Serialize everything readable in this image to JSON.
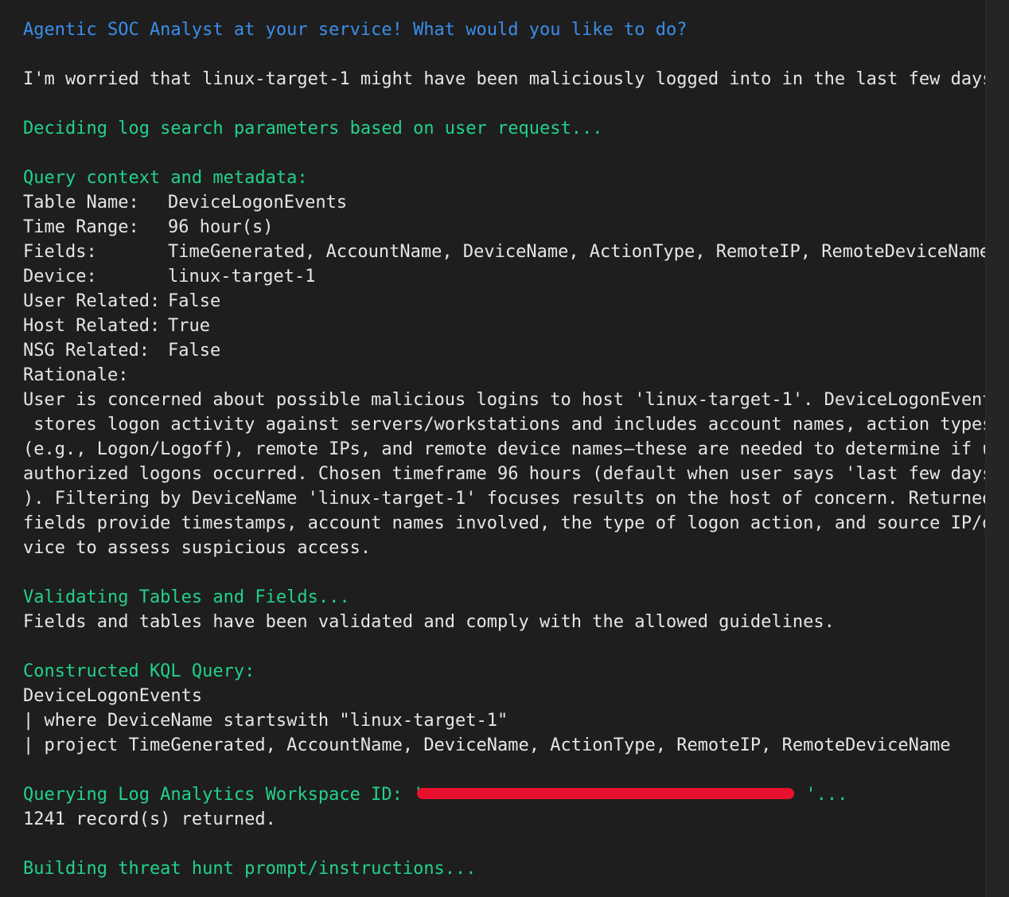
{
  "greeting": "Agentic SOC Analyst at your service! What would you like to do?",
  "user_prompt": "I'm worried that linux-target-1 might have been maliciously logged into in the last few days",
  "deciding": "Deciding log search parameters based on user request...",
  "context_header": "Query context and metadata:",
  "context": {
    "table_name_label": "Table Name:",
    "table_name_value": "DeviceLogonEvents",
    "time_range_label": "Time Range:",
    "time_range_value": "96 hour(s)",
    "fields_label": "Fields:",
    "fields_value": "TimeGenerated, AccountName, DeviceName, ActionType, RemoteIP, RemoteDeviceName",
    "device_label": "Device:",
    "device_value": "linux-target-1",
    "user_related_label": "User Related:",
    "user_related_value": "False",
    "host_related_label": "Host Related:",
    "host_related_value": "True",
    "nsg_related_label": "NSG Related:",
    "nsg_related_value": "False",
    "rationale_label": "Rationale:"
  },
  "rationale_lines": [
    "User is concerned about possible malicious logins to host 'linux-target-1'. DeviceLogonEvents",
    " stores logon activity against servers/workstations and includes account names, action types",
    "(e.g., Logon/Logoff), remote IPs, and remote device names—these are needed to determine if un",
    "authorized logons occurred. Chosen timeframe 96 hours (default when user says 'last few days'",
    "). Filtering by DeviceName 'linux-target-1' focuses results on the host of concern. Returned",
    "fields provide timestamps, account names involved, the type of logon action, and source IP/de",
    "vice to assess suspicious access."
  ],
  "validating_header": "Validating Tables and Fields...",
  "validating_result": "Fields and tables have been validated and comply with the allowed guidelines.",
  "kql_header": "Constructed KQL Query:",
  "kql_lines": [
    "DeviceLogonEvents",
    "| where DeviceName startswith \"linux-target-1\"",
    "| project TimeGenerated, AccountName, DeviceName, ActionType, RemoteIP, RemoteDeviceName"
  ],
  "querying_prefix": "Querying Log Analytics Workspace ID: '",
  "querying_suffix": "'...",
  "records_returned": "1241 record(s) returned.",
  "building": "Building threat hunt prompt/instructions...",
  "colors": {
    "background": "#1e1e1e",
    "prompt_blue": "#3b8eea",
    "status_green": "#23d18b",
    "text": "#e6e6e6",
    "redaction": "#e8112d"
  }
}
